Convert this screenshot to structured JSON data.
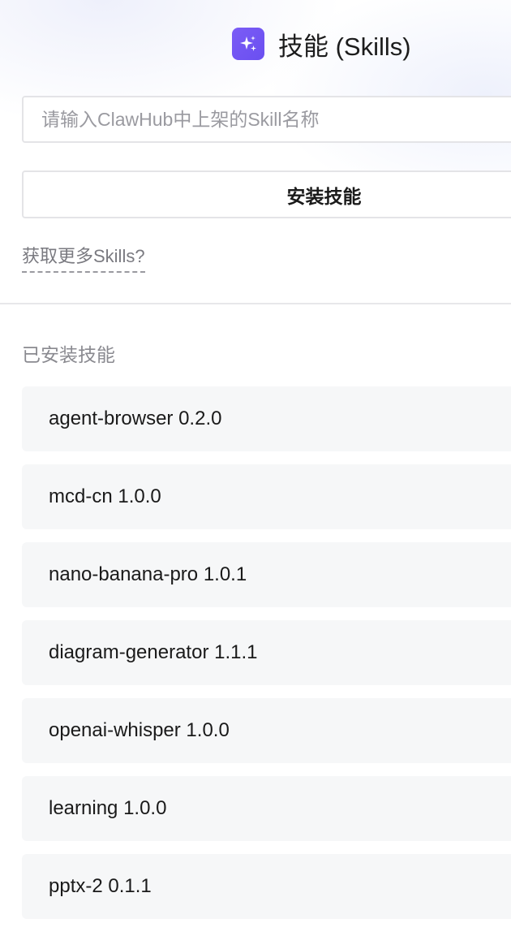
{
  "header": {
    "title": "技能 (Skills)",
    "icon": "sparkle-icon",
    "accent_color": "#7b5cf6"
  },
  "install_form": {
    "input_placeholder": "请输入ClawHub中上架的Skill名称",
    "input_value": "",
    "install_button_label": "安装技能",
    "more_link_label": "获取更多Skills?"
  },
  "installed": {
    "title": "已安装技能",
    "items": [
      {
        "label": "agent-browser 0.2.0"
      },
      {
        "label": "mcd-cn 1.0.0"
      },
      {
        "label": "nano-banana-pro 1.0.1"
      },
      {
        "label": "diagram-generator 1.1.1"
      },
      {
        "label": "openai-whisper 1.0.0"
      },
      {
        "label": "learning 1.0.0"
      },
      {
        "label": "pptx-2 0.1.1"
      }
    ]
  }
}
